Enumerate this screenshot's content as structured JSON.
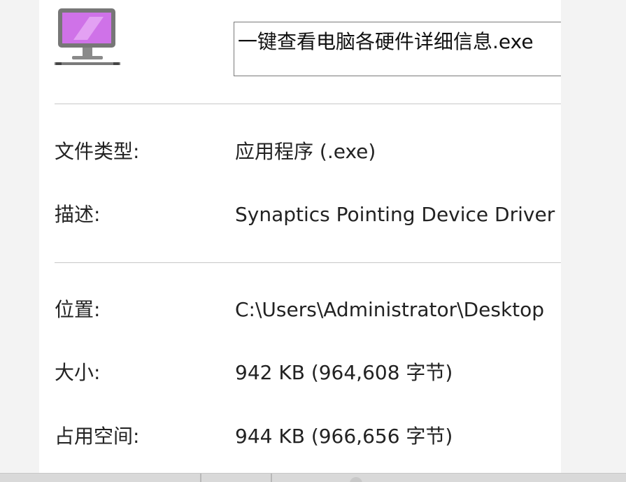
{
  "dialog": {
    "icon": "monitor-icon",
    "file_name": "一键查看电脑各硬件详细信息.exe"
  },
  "properties": {
    "type_label": "文件类型:",
    "type_value": "应用程序 (.exe)",
    "description_label": "描述:",
    "description_value": "Synaptics Pointing Device Driver",
    "location_label": "位置:",
    "location_value": "C:\\Users\\Administrator\\Desktop",
    "size_label": "大小:",
    "size_value": "942 KB (964,608 字节)",
    "disk_size_label": "占用空间:",
    "disk_size_value": "944 KB (966,656 字节)"
  },
  "colors": {
    "icon_screen": "#cf72e8",
    "icon_bezel": "#777777",
    "divider": "#c8c8c8",
    "text": "#222222"
  }
}
